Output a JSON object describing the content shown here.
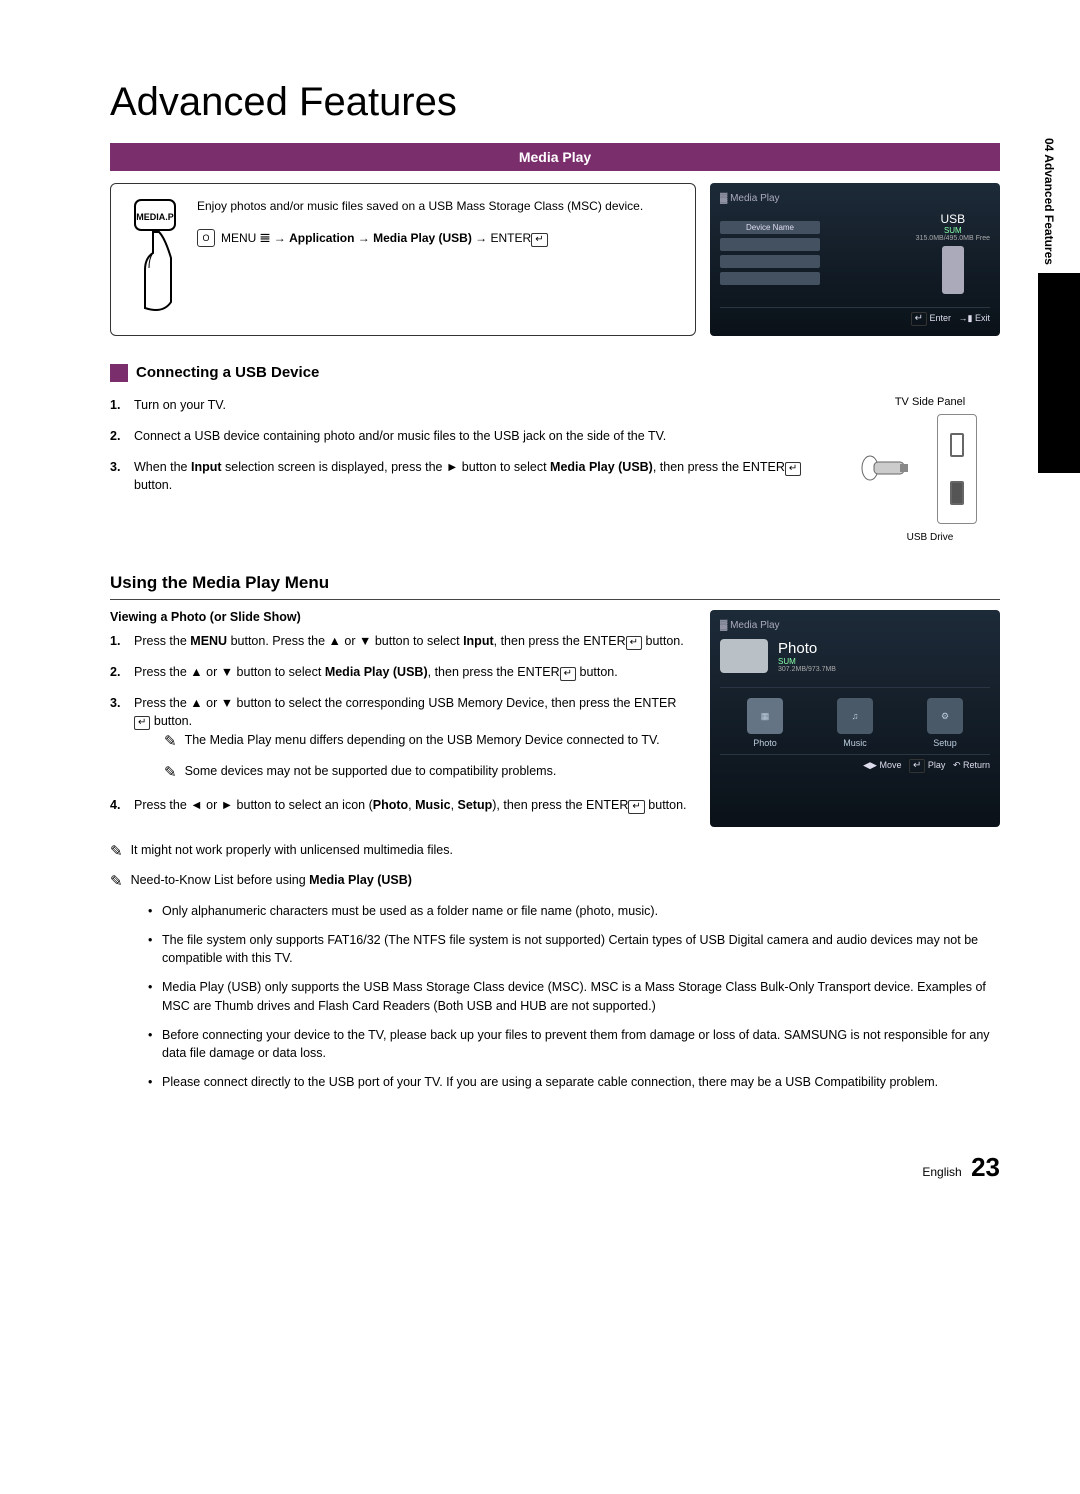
{
  "page_title": "Advanced Features",
  "side_tab": "04 Advanced Features",
  "media_bar": "Media Play",
  "remote_button": "MEDIA.P",
  "intro_text": "Enjoy photos and/or music files saved on a USB Mass Storage Class (MSC) device.",
  "menu_path": {
    "menu_word": "MENU",
    "application": "Application",
    "media_play": "Media Play (USB)",
    "enter": "ENTER"
  },
  "media_screen": {
    "header": "Media Play",
    "device_name": "Device Name",
    "usb": "USB",
    "sum": "SUM",
    "free": "315.0MB/495.0MB Free",
    "enter_btn": "Enter",
    "exit_btn": "Exit"
  },
  "sec1_title": "Connecting a USB Device",
  "steps1": {
    "s1": "Turn on your TV.",
    "s2": "Connect a USB device containing photo and/or music files to the USB jack on the side of the TV.",
    "s3_a": "When the ",
    "s3_b": "Input",
    "s3_c": " selection screen is displayed, press the ► button to select ",
    "s3_d": "Media Play (USB)",
    "s3_e": ", then press the ENTER",
    "s3_f": " button."
  },
  "panel": {
    "title": "TV Side Panel",
    "usb_drive": "USB Drive"
  },
  "sec2_title": "Using the Media Play Menu",
  "view_title": "Viewing a Photo (or Slide Show)",
  "steps2": {
    "s1_a": "Press the ",
    "s1_b": "MENU",
    "s1_c": " button. Press the ▲ or ▼ button to select ",
    "s1_d": "Input",
    "s1_e": ", then press the ENTER",
    "s1_f": " button.",
    "s2_a": "Press the ▲ or ▼ button to select ",
    "s2_b": "Media Play (USB)",
    "s2_c": ", then press the ENTER",
    "s2_d": " button.",
    "s3_a": "Press the ▲ or ▼ button to select the corresponding USB Memory Device, then press the ENTER",
    "s3_b": " button.",
    "s3_n1": "The Media Play menu differs depending on the USB Memory Device connected to TV.",
    "s3_n2": "Some devices may not be supported due to compatibility problems.",
    "s4_a": "Press the ◄ or ► button to select an icon (",
    "s4_b": "Photo",
    "s4_c": ", ",
    "s4_d": "Music",
    "s4_e": ", ",
    "s4_f": "Setup",
    "s4_g": "), then press the ENTER",
    "s4_h": " button."
  },
  "photo_screen": {
    "header": "Media Play",
    "title": "Photo",
    "sum": "SUM",
    "free": "307.2MB/973.7MB",
    "photo": "Photo",
    "music": "Music",
    "setup": "Setup",
    "move": "Move",
    "play": "Play",
    "return": "Return"
  },
  "note1": "It might not work properly with unlicensed multimedia files.",
  "note2_a": "Need-to-Know List before using ",
  "note2_b": "Media Play (USB)",
  "bullets": {
    "b1": "Only alphanumeric characters must be used as a folder name or file name (photo, music).",
    "b2": "The file system only supports FAT16/32 (The NTFS file system is not supported) Certain types of USB Digital camera and audio devices may not be compatible with this TV.",
    "b3": "Media Play (USB) only supports the USB Mass Storage Class device (MSC). MSC is a Mass Storage Class Bulk-Only Transport device. Examples of MSC are Thumb drives and Flash Card Readers (Both USB and HUB are not supported.)",
    "b4": "Before connecting your device to the TV, please back up your files to prevent them from damage or loss of data. SAMSUNG is not responsible for any data file damage or data loss.",
    "b5": "Please connect directly to the USB port of your TV. If you are using a separate cable connection, there may be a USB Compatibility problem."
  },
  "footer_lang": "English",
  "footer_page": "23"
}
